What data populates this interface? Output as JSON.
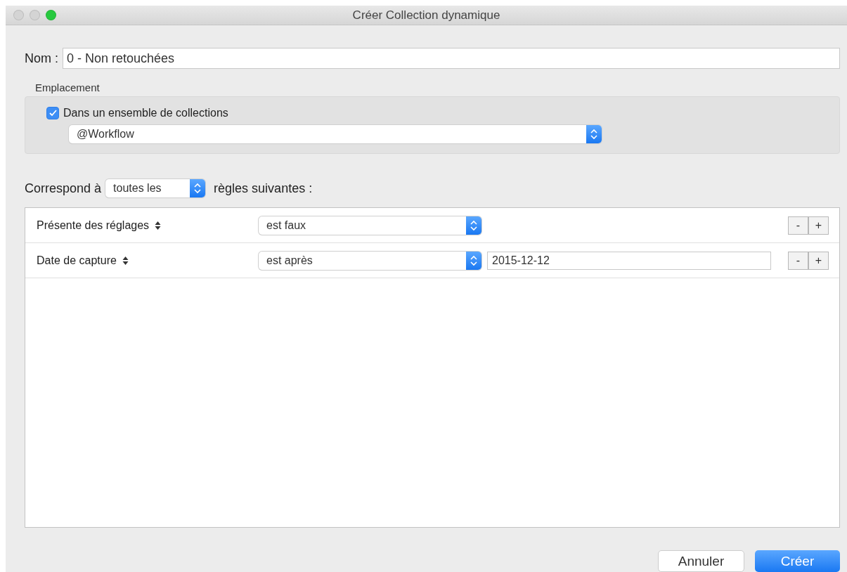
{
  "window": {
    "title": "Créer Collection dynamique"
  },
  "name": {
    "label": "Nom :",
    "value": "0 - Non retouchées"
  },
  "location": {
    "label": "Emplacement",
    "checkbox": {
      "label": "Dans un ensemble de collections",
      "checked": true
    },
    "select": {
      "value": "@Workflow"
    }
  },
  "match": {
    "prefix": "Correspond à",
    "select": {
      "value": "toutes les"
    },
    "suffix": "règles suivantes :"
  },
  "rules": [
    {
      "attribute": "Présente des réglages",
      "operator": "est faux",
      "remove": "-",
      "add": "+"
    },
    {
      "attribute": "Date de capture",
      "operator": "est après",
      "value": "2015-12-12",
      "remove": "-",
      "add": "+"
    }
  ],
  "buttons": [
    {
      "label": "Annuler",
      "kind": "default"
    },
    {
      "label": "Créer",
      "kind": "primary"
    }
  ]
}
